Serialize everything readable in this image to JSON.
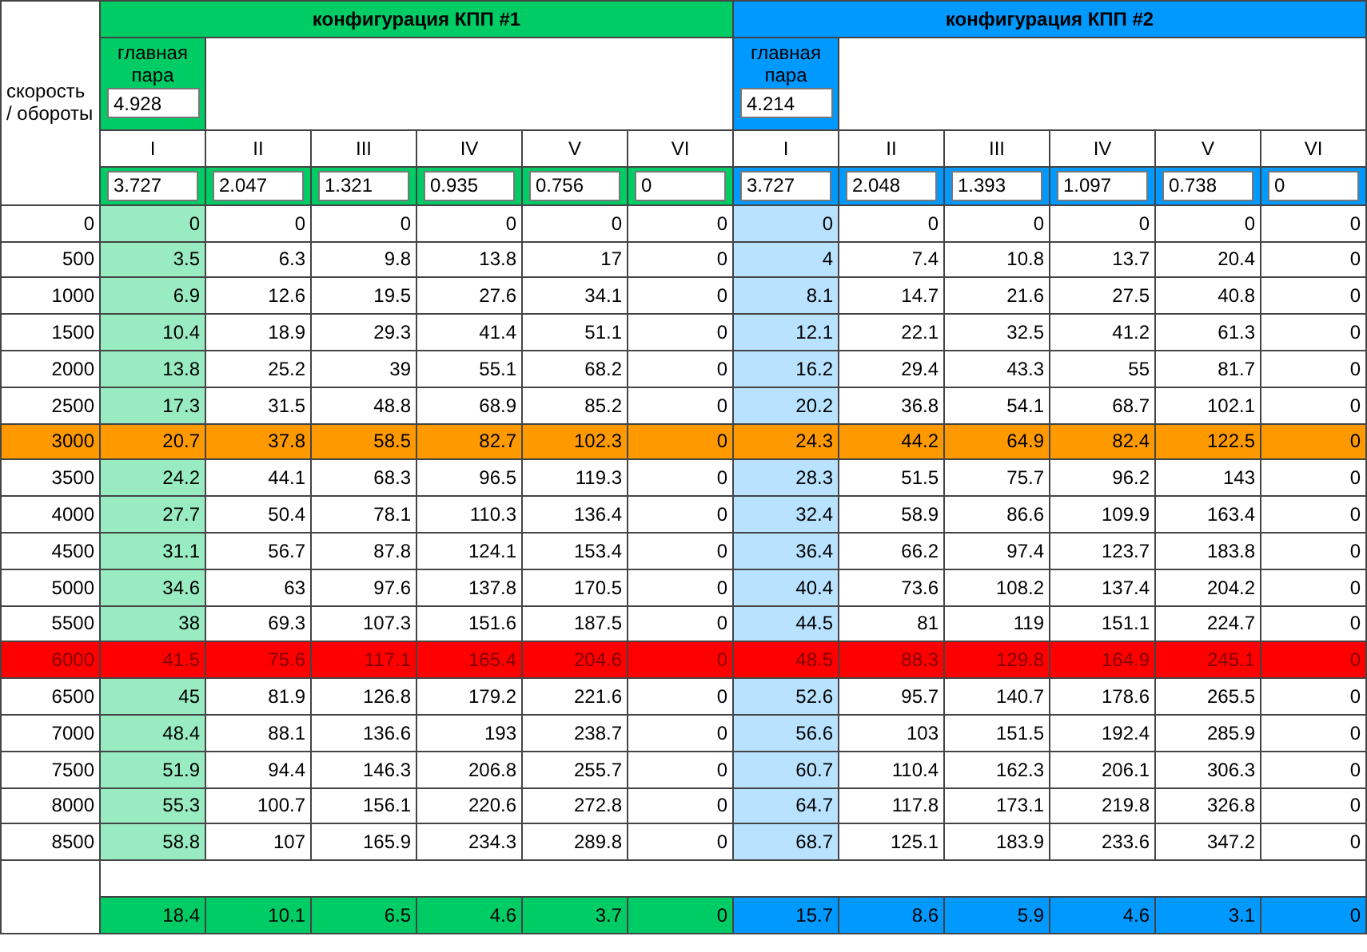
{
  "corner_label": "скорость / обороты",
  "configs": [
    {
      "title": "конфигурация КПП #1",
      "color": "#00cc66",
      "main_pair_label": "главная пара",
      "main_pair": "4.928",
      "gears": [
        "I",
        "II",
        "III",
        "IV",
        "V",
        "VI"
      ],
      "ratios": [
        "3.727",
        "2.047",
        "1.321",
        "0.935",
        "0.756",
        "0"
      ],
      "totals": [
        "18.4",
        "10.1",
        "6.5",
        "4.6",
        "3.7",
        "0"
      ]
    },
    {
      "title": "конфигурация КПП #2",
      "color": "#0099ff",
      "main_pair_label": "главная пара",
      "main_pair": "4.214",
      "gears": [
        "I",
        "II",
        "III",
        "IV",
        "V",
        "VI"
      ],
      "ratios": [
        "3.727",
        "2.048",
        "1.393",
        "1.097",
        "0.738",
        "0"
      ],
      "totals": [
        "15.7",
        "8.6",
        "5.9",
        "4.6",
        "3.1",
        "0"
      ]
    }
  ],
  "rows": [
    {
      "rpm": "0",
      "kind": "normal",
      "values": [
        "0",
        "0",
        "0",
        "0",
        "0",
        "0",
        "0",
        "0",
        "0",
        "0",
        "0",
        "0"
      ]
    },
    {
      "rpm": "500",
      "kind": "normal",
      "values": [
        "3.5",
        "6.3",
        "9.8",
        "13.8",
        "17",
        "0",
        "4",
        "7.4",
        "10.8",
        "13.7",
        "20.4",
        "0"
      ]
    },
    {
      "rpm": "1000",
      "kind": "normal",
      "values": [
        "6.9",
        "12.6",
        "19.5",
        "27.6",
        "34.1",
        "0",
        "8.1",
        "14.7",
        "21.6",
        "27.5",
        "40.8",
        "0"
      ]
    },
    {
      "rpm": "1500",
      "kind": "normal",
      "values": [
        "10.4",
        "18.9",
        "29.3",
        "41.4",
        "51.1",
        "0",
        "12.1",
        "22.1",
        "32.5",
        "41.2",
        "61.3",
        "0"
      ]
    },
    {
      "rpm": "2000",
      "kind": "normal",
      "values": [
        "13.8",
        "25.2",
        "39",
        "55.1",
        "68.2",
        "0",
        "16.2",
        "29.4",
        "43.3",
        "55",
        "81.7",
        "0"
      ]
    },
    {
      "rpm": "2500",
      "kind": "normal",
      "values": [
        "17.3",
        "31.5",
        "48.8",
        "68.9",
        "85.2",
        "0",
        "20.2",
        "36.8",
        "54.1",
        "68.7",
        "102.1",
        "0"
      ]
    },
    {
      "rpm": "3000",
      "kind": "warning",
      "values": [
        "20.7",
        "37.8",
        "58.5",
        "82.7",
        "102.3",
        "0",
        "24.3",
        "44.2",
        "64.9",
        "82.4",
        "122.5",
        "0"
      ]
    },
    {
      "rpm": "3500",
      "kind": "normal",
      "values": [
        "24.2",
        "44.1",
        "68.3",
        "96.5",
        "119.3",
        "0",
        "28.3",
        "51.5",
        "75.7",
        "96.2",
        "143",
        "0"
      ]
    },
    {
      "rpm": "4000",
      "kind": "normal",
      "values": [
        "27.7",
        "50.4",
        "78.1",
        "110.3",
        "136.4",
        "0",
        "32.4",
        "58.9",
        "86.6",
        "109.9",
        "163.4",
        "0"
      ]
    },
    {
      "rpm": "4500",
      "kind": "normal",
      "values": [
        "31.1",
        "56.7",
        "87.8",
        "124.1",
        "153.4",
        "0",
        "36.4",
        "66.2",
        "97.4",
        "123.7",
        "183.8",
        "0"
      ]
    },
    {
      "rpm": "5000",
      "kind": "normal",
      "values": [
        "34.6",
        "63",
        "97.6",
        "137.8",
        "170.5",
        "0",
        "40.4",
        "73.6",
        "108.2",
        "137.4",
        "204.2",
        "0"
      ]
    },
    {
      "rpm": "5500",
      "kind": "normal",
      "values": [
        "38",
        "69.3",
        "107.3",
        "151.6",
        "187.5",
        "0",
        "44.5",
        "81",
        "119",
        "151.1",
        "224.7",
        "0"
      ]
    },
    {
      "rpm": "6000",
      "kind": "limit",
      "values": [
        "41.5",
        "75.6",
        "117.1",
        "165.4",
        "204.6",
        "0",
        "48.5",
        "88.3",
        "129.8",
        "164.9",
        "245.1",
        "0"
      ]
    },
    {
      "rpm": "6500",
      "kind": "normal",
      "values": [
        "45",
        "81.9",
        "126.8",
        "179.2",
        "221.6",
        "0",
        "52.6",
        "95.7",
        "140.7",
        "178.6",
        "265.5",
        "0"
      ]
    },
    {
      "rpm": "7000",
      "kind": "normal",
      "values": [
        "48.4",
        "88.1",
        "136.6",
        "193",
        "238.7",
        "0",
        "56.6",
        "103",
        "151.5",
        "192.4",
        "285.9",
        "0"
      ]
    },
    {
      "rpm": "7500",
      "kind": "normal",
      "values": [
        "51.9",
        "94.4",
        "146.3",
        "206.8",
        "255.7",
        "0",
        "60.7",
        "110.4",
        "162.3",
        "206.1",
        "306.3",
        "0"
      ]
    },
    {
      "rpm": "8000",
      "kind": "normal",
      "values": [
        "55.3",
        "100.7",
        "156.1",
        "220.6",
        "272.8",
        "0",
        "64.7",
        "117.8",
        "173.1",
        "219.8",
        "326.8",
        "0"
      ]
    },
    {
      "rpm": "8500",
      "kind": "normal",
      "values": [
        "58.8",
        "107",
        "165.9",
        "234.3",
        "289.8",
        "0",
        "68.7",
        "125.1",
        "183.9",
        "233.6",
        "347.2",
        "0"
      ]
    }
  ]
}
